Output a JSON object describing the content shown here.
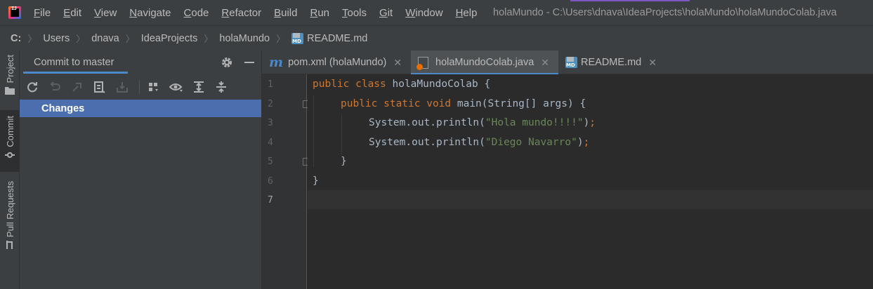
{
  "menubar": {
    "logo_text": "IJ",
    "items": [
      {
        "mnemonic": "F",
        "rest": "ile"
      },
      {
        "mnemonic": "E",
        "rest": "dit"
      },
      {
        "mnemonic": "V",
        "rest": "iew"
      },
      {
        "mnemonic": "N",
        "rest": "avigate"
      },
      {
        "mnemonic": "C",
        "rest": "ode"
      },
      {
        "mnemonic": "R",
        "rest": "efactor"
      },
      {
        "mnemonic": "B",
        "rest": "uild"
      },
      {
        "mnemonic": "R",
        "rest": "un"
      },
      {
        "mnemonic": "T",
        "rest": "ools"
      },
      {
        "mnemonic": "G",
        "rest": "it"
      },
      {
        "mnemonic": "W",
        "rest": "indow"
      },
      {
        "mnemonic": "H",
        "rest": "elp"
      }
    ],
    "window_title": "holaMundo - C:\\Users\\dnava\\IdeaProjects\\holaMundo\\holaMundoColab.java"
  },
  "breadcrumb": {
    "items": [
      "C:",
      "Users",
      "dnava",
      "IdeaProjects",
      "holaMundo",
      "README.md"
    ],
    "md_icon_text": "MD"
  },
  "tool_stripe": {
    "project": "Project",
    "commit": "Commit",
    "pull_requests": "Pull Requests"
  },
  "commit_panel": {
    "title": "Commit to master",
    "changes_label": "Changes"
  },
  "editor_tabs": [
    {
      "label": "pom.xml (holaMundo)",
      "icon": "maven-icon",
      "icon_glyph": "m",
      "active": false
    },
    {
      "label": "holaMundoColab.java",
      "icon": "java-class-icon",
      "active": true
    },
    {
      "label": "README.md",
      "icon": "markdown-icon",
      "active": false
    }
  ],
  "editor": {
    "line_numbers": [
      "1",
      "2",
      "3",
      "4",
      "5",
      "6",
      "7"
    ],
    "current_line": 7,
    "code": {
      "l1_kw": "public class",
      "l1_rest": " holaMundoColab {",
      "l2_kw": "public static void",
      "l2_rest": " main(String[] args) {",
      "l3_pre": "System.out.println(",
      "l3_str": "\"Hola mundo!!!!\"",
      "l3_post": ")",
      "l3_semi": ";",
      "l4_pre": "System.out.println(",
      "l4_str": "\"Diego Navarro\"",
      "l4_post": ")",
      "l4_semi": ";",
      "l5": "}",
      "l6": "}"
    }
  },
  "colors": {
    "accent": "#4a88c7",
    "selection": "#4b6eaf",
    "keyword": "#cc7832",
    "string": "#6a8759"
  }
}
